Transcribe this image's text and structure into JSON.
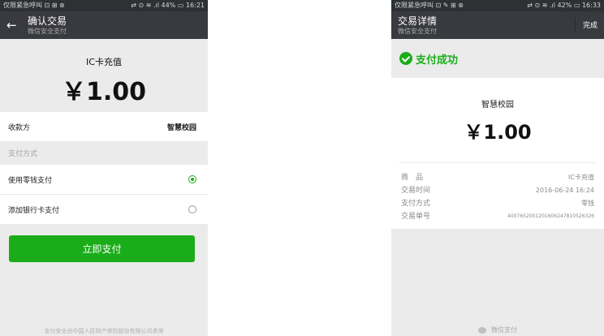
{
  "left": {
    "status": {
      "left": "仅限紧急呼叫 ⊡ ⊞ ⊛",
      "right": "⇄ ⊙ ≋ .ıl 44% ▭ 16:21"
    },
    "title": "确认交易",
    "subtitle": "微信安全支付",
    "back_icon": "arrow-left-icon",
    "amount_title": "IC卡充值",
    "amount": "￥1.00",
    "payee_label": "收款方",
    "payee_value": "智慧校园",
    "method_header": "支付方式",
    "methods": [
      {
        "label": "使用零钱支付",
        "selected": true
      },
      {
        "label": "添加银行卡支付",
        "selected": false
      }
    ],
    "pay_button": "立即支付",
    "footer": "支付安全由中国人民财产保险股份有限公司承保",
    "accent_color": "#1aad19"
  },
  "right": {
    "status": {
      "left": "仅限紧急呼叫 ⊡ ✎ ⊞ ⊛",
      "right": "⇄ ⊙ ≋ .ıl 42% ▭ 16:33"
    },
    "title": "交易详情",
    "subtitle": "微信安全支付",
    "done": "完成",
    "success": "支付成功",
    "merchant": "智慧校园",
    "amount": "￥1.00",
    "details": [
      {
        "label": "商　品",
        "value": "IC卡充值"
      },
      {
        "label": "交易时间",
        "value": "2016-06-24 16:24"
      },
      {
        "label": "支付方式",
        "value": "零钱"
      },
      {
        "label": "交易单号",
        "value": "4007652001201606247810526326"
      }
    ],
    "footer": "微信支付"
  }
}
